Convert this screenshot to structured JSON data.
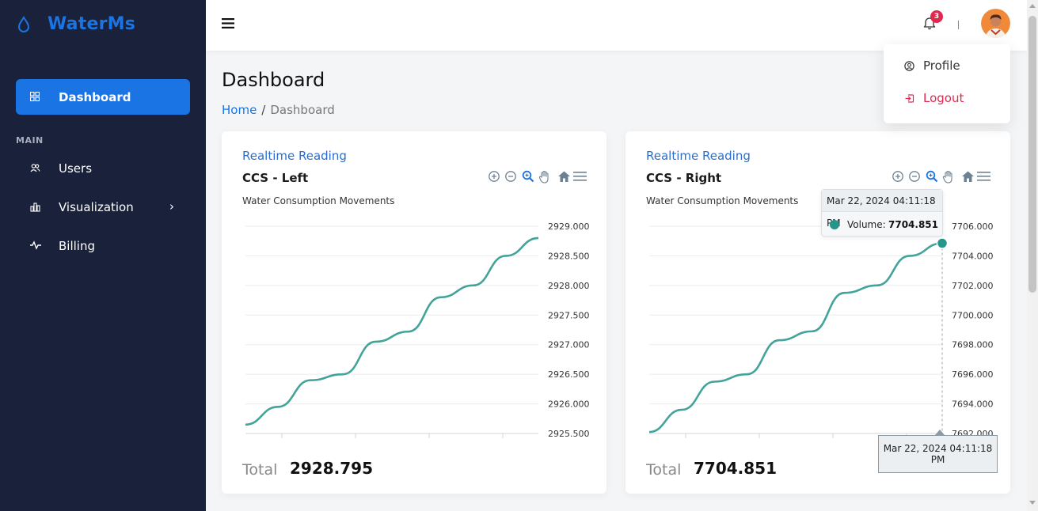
{
  "brand": {
    "name": "WaterMs",
    "icon": "water-drop-icon",
    "color": "#1b74e4"
  },
  "sidebar": {
    "active_item": {
      "label": "Dashboard",
      "icon": "grid-icon"
    },
    "section_title": "MAIN",
    "items": [
      {
        "label": "Users",
        "icon": "users-icon"
      },
      {
        "label": "Visualization",
        "icon": "bar-chart-icon",
        "has_submenu": true
      },
      {
        "label": "Billing",
        "icon": "activity-icon"
      }
    ]
  },
  "topbar": {
    "notification_count": "3"
  },
  "user_menu": {
    "profile_label": "Profile",
    "logout_label": "Logout"
  },
  "page": {
    "title": "Dashboard",
    "breadcrumb": {
      "home": "Home",
      "separator": "/",
      "current": "Dashboard"
    }
  },
  "cards": [
    {
      "subtitle": "Realtime Reading",
      "title": "CCS - Left",
      "total_label": "Total",
      "total_value": "2928.795"
    },
    {
      "subtitle": "Realtime Reading",
      "title": "CCS - Right",
      "total_label": "Total",
      "total_value": "7704.851",
      "tooltip": {
        "title": "Mar 22, 2024 04:11:18 PM",
        "series_label": "Volume:",
        "value": "7704.851",
        "x_label": "Mar 22, 2024 04:11:18 PM"
      }
    }
  ],
  "chart_data": [
    {
      "type": "line",
      "title": "Water Consumption Movements",
      "series_color": "#43a39a",
      "ylim": [
        2925.5,
        2929.0
      ],
      "ticks": [
        "2929.000",
        "2928.500",
        "2928.000",
        "2927.500",
        "2927.000",
        "2926.500",
        "2926.000",
        "2925.500"
      ],
      "y_axis_position": "right",
      "grid": true,
      "series": [
        {
          "values": [
            2925.65,
            2925.95,
            2926.4,
            2926.5,
            2927.05,
            2927.22,
            2927.8,
            2928.0,
            2928.5,
            2928.8
          ]
        }
      ]
    },
    {
      "type": "line",
      "title": "Water Consumption Movements",
      "series_color": "#43a39a",
      "ylim": [
        7692.0,
        7706.0
      ],
      "ticks": [
        "7706.000",
        "7704.000",
        "7702.000",
        "7700.000",
        "7698.000",
        "7696.000",
        "7694.000",
        "7692.000"
      ],
      "y_axis_position": "right",
      "grid": true,
      "series": [
        {
          "name": "Volume",
          "values": [
            7692.1,
            7693.6,
            7695.5,
            7696.0,
            7698.3,
            7698.9,
            7701.5,
            7702.0,
            7704.0,
            7704.851
          ]
        }
      ]
    }
  ]
}
